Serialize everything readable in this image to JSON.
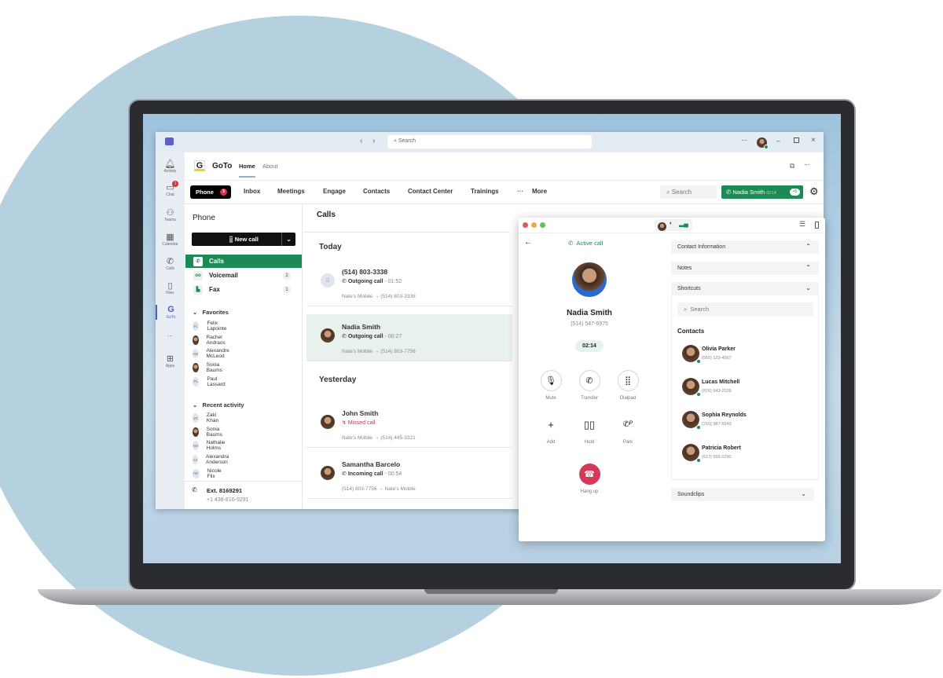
{
  "titlebar": {
    "search_placeholder": "Search"
  },
  "rail": [
    {
      "label": "Activity",
      "icon": "bell-icon"
    },
    {
      "label": "Chat",
      "icon": "chat-icon",
      "badge": "1"
    },
    {
      "label": "Teams",
      "icon": "teams-icon"
    },
    {
      "label": "Calendar",
      "icon": "calendar-icon"
    },
    {
      "label": "Calls",
      "icon": "phone-icon"
    },
    {
      "label": "Files",
      "icon": "file-icon"
    },
    {
      "label": "GoTo",
      "icon": "goto-icon"
    },
    {
      "label": "...",
      "icon": "more-icon"
    },
    {
      "label": "Apps",
      "icon": "apps-icon"
    }
  ],
  "app": {
    "name": "GoTo",
    "logo": "G",
    "tabs": [
      "Home",
      "About"
    ]
  },
  "nav": {
    "phone": "Phone",
    "phone_badge": "3",
    "items": [
      "Inbox",
      "Meetings",
      "Engage",
      "Contacts",
      "Contact Center",
      "Trainings"
    ],
    "more": "More",
    "search": "Search",
    "active_call_name": "Nadia Smith",
    "active_call_time": "02:14",
    "active_call_extra": "+5"
  },
  "left": {
    "title": "Phone",
    "new_call": "New call",
    "calls": "Calls",
    "voicemail": "Voicemail",
    "voicemail_count": "2",
    "fax": "Fax",
    "fax_count": "1",
    "favorites_title": "Favorites",
    "favorites": [
      {
        "initials": "FL",
        "name": "Felix Lapointe"
      },
      {
        "initials": "",
        "name": "Rachel Andraos"
      },
      {
        "initials": "AM",
        "name": "Alexandre McLeod"
      },
      {
        "initials": "",
        "name": "Sonia Baums"
      },
      {
        "initials": "PL",
        "name": "Paul Lassard"
      }
    ],
    "recent_title": "Recent activity",
    "recent": [
      {
        "initials": "ZK",
        "name": "Zaki Khan"
      },
      {
        "initials": "",
        "name": "Sonia Baums"
      },
      {
        "initials": "NH",
        "name": "Nathalie Holms"
      },
      {
        "initials": "AA",
        "name": "Alexandra Anderson"
      },
      {
        "initials": "NF",
        "name": "Nicole Flix"
      }
    ],
    "ext": "Ext. 8169291",
    "ext_number": "+1 438-816-9291"
  },
  "calls": {
    "title": "Calls",
    "today": "Today",
    "yesterday": "Yesterday",
    "rows": [
      {
        "name": "(514) 803-3338",
        "type": "Outgoing call",
        "duration": "- 01:52",
        "route": "Nate's Mobile → (514) 803-3338"
      },
      {
        "name": "Nadia Smith",
        "type": "Outgoing call",
        "duration": "- 00:27",
        "route": "Nate's Mobile → (514) 803-7756"
      },
      {
        "name": "John Smith",
        "type": "Missed call",
        "duration": "",
        "route": "Nate's Mobile → (514) 445-3321"
      },
      {
        "name": "Samantha Barcelo",
        "type": "Incoming call",
        "duration": "- 00:54",
        "route": "(514) 803-7756 → Nate's Mobile"
      }
    ]
  },
  "popup": {
    "status": "Active call",
    "name": "Nadia Smith",
    "number": "(514) 547-6975",
    "timer": "02:14",
    "controls": [
      "Mute",
      "Transfer",
      "Dialpad",
      "Add",
      "Hold",
      "Park"
    ],
    "hangup": "Hang up",
    "sections": {
      "contact_info": "Contact Information",
      "notes": "Notes",
      "shortcuts": "Shortcuts",
      "soundclips": "Soundclips"
    },
    "search_placeholder": "Search",
    "contacts_title": "Contacts",
    "contacts": [
      {
        "name": "Olivia Parker",
        "phone": "(555) 123-4567"
      },
      {
        "name": "Lucas Mitchell",
        "phone": "(876) 543-2109"
      },
      {
        "name": "Sophia Reynolds",
        "phone": "(210) 987-6543"
      },
      {
        "name": "Patricia Robert",
        "phone": "(617) 555-0290"
      }
    ]
  },
  "colors": {
    "accent": "#1c8a55",
    "missed": "#d9304f",
    "hangup": "#d23a57",
    "backdrop_circle": "#b5d0de"
  }
}
